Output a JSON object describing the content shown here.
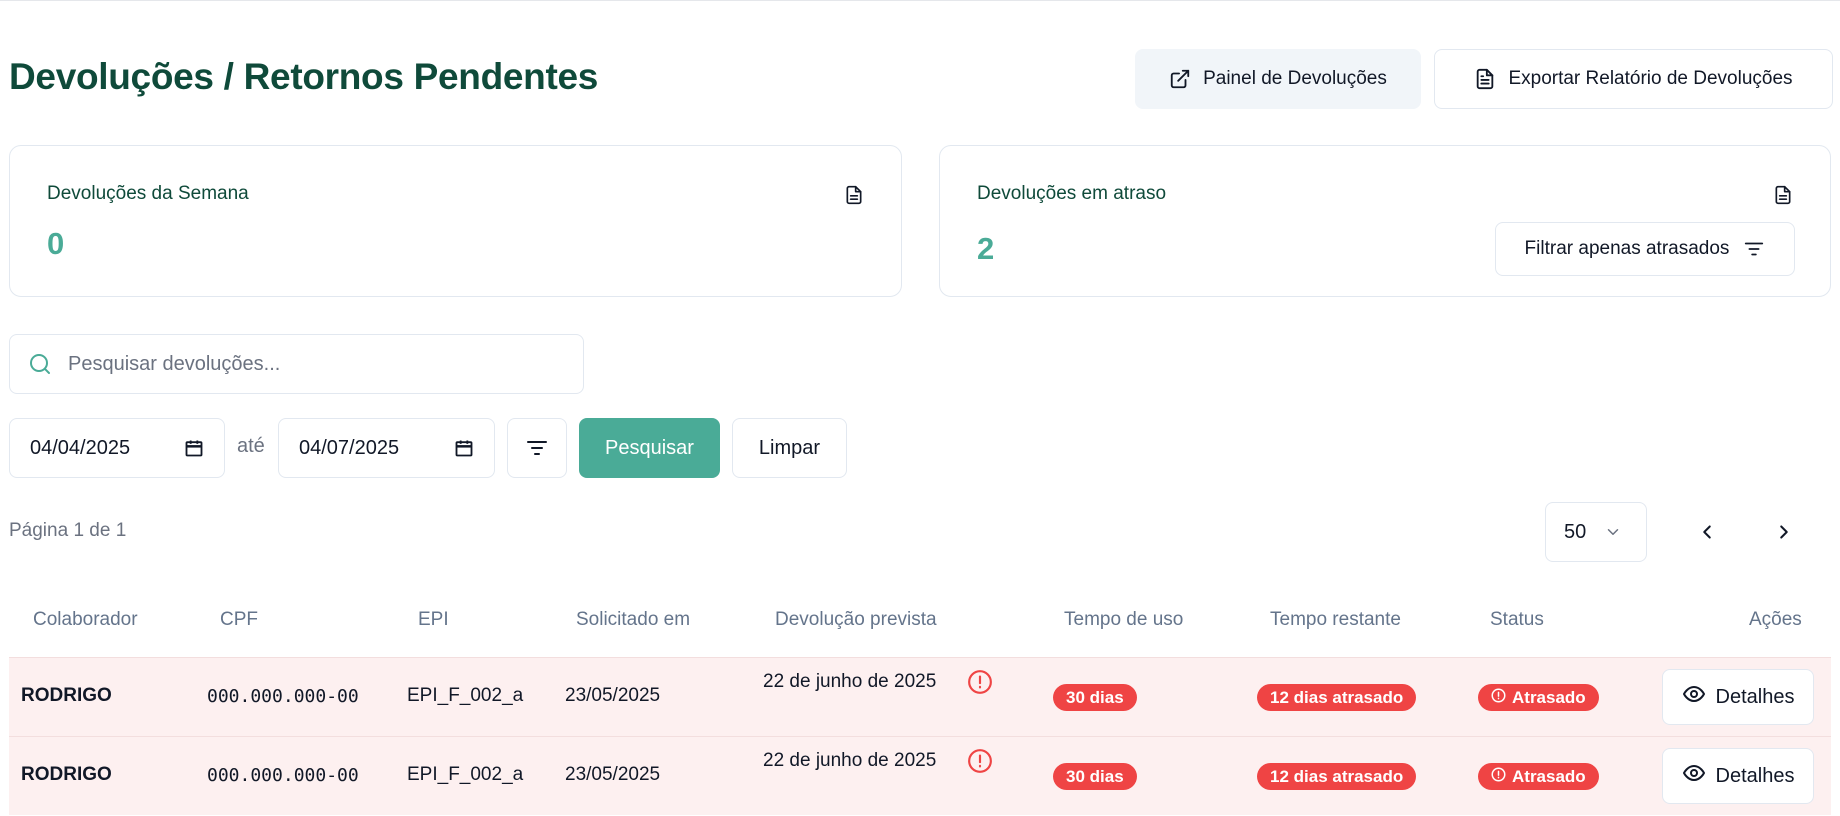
{
  "page": {
    "title": "Devoluções / Retornos Pendentes",
    "buttons": {
      "panel_label": "Painel de Devoluções",
      "export_label": "Exportar Relatório de Devoluções"
    }
  },
  "cards": {
    "week": {
      "title": "Devoluções da Semana",
      "value": "0"
    },
    "overdue": {
      "title": "Devoluções em atraso",
      "value": "2",
      "filter_label": "Filtrar apenas atrasados"
    }
  },
  "filters": {
    "search_placeholder": "Pesquisar devoluções...",
    "date_from": "04/04/2025",
    "date_separator": "até",
    "date_to": "04/07/2025",
    "search_button": "Pesquisar",
    "clear_button": "Limpar"
  },
  "pagination": {
    "page_info": "Página 1 de 1",
    "page_size": "50"
  },
  "table": {
    "headers": [
      "Colaborador",
      "CPF",
      "EPI",
      "Solicitado em",
      "Devolução prevista",
      "Tempo de uso",
      "Tempo restante",
      "Status",
      "Ações"
    ],
    "rows": [
      {
        "colaborador": "RODRIGO",
        "cpf": "000.000.000-00",
        "epi": "EPI_F_002_a",
        "solicitado": "23/05/2025",
        "prevista": "22 de junho de 2025",
        "uso": "30 dias",
        "restante": "12 dias atrasado",
        "status": "Atrasado",
        "acao": "Detalhes"
      },
      {
        "colaborador": "RODRIGO",
        "cpf": "000.000.000-00",
        "epi": "EPI_F_002_a",
        "solicitado": "23/05/2025",
        "prevista": "22 de junho de 2025",
        "uso": "30 dias",
        "restante": "12 dias atrasado",
        "status": "Atrasado",
        "acao": "Detalhes"
      }
    ]
  },
  "colors": {
    "brand_dark": "#0f4a3a",
    "accent": "#4aab97",
    "danger": "#ef4444",
    "row_overdue_bg": "#fdf0f0"
  }
}
